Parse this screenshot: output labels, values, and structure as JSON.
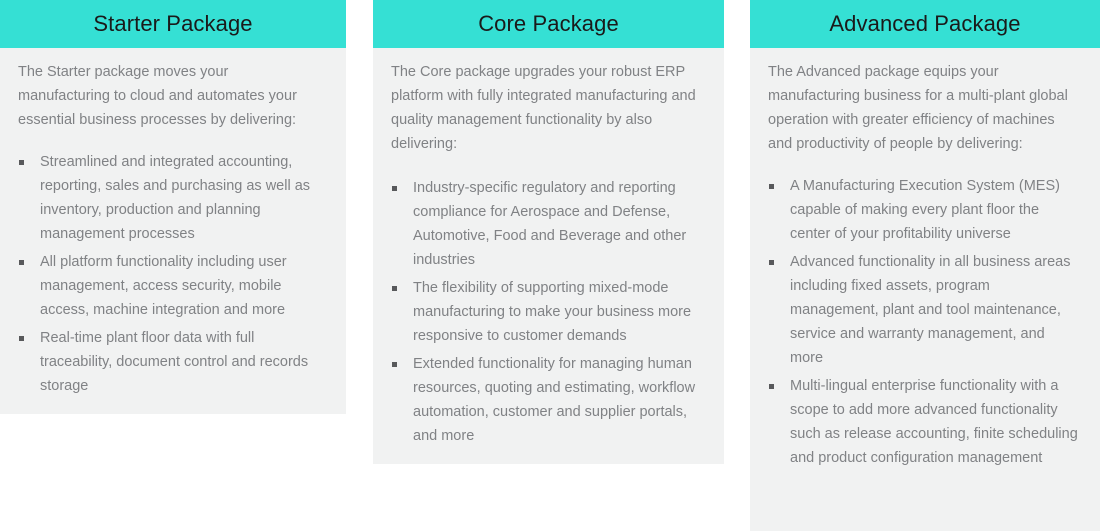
{
  "theme": {
    "header_background": "#35e0d4",
    "header_text_color": "#1a1a1a",
    "body_background": "#f1f2f2",
    "body_text_color": "#808285",
    "bullet_color": "#58595b",
    "page_background": "#ffffff"
  },
  "packages": [
    {
      "title": "Starter Package",
      "intro": "The Starter package moves your manufacturing to cloud and automates your essential business processes by delivering:",
      "items": [
        "Streamlined and integrated accounting, reporting, sales and purchasing as well as inventory, production and planning management processes",
        "All platform functionality including user management, access security, mobile access, machine integration and more",
        "Real-time plant floor data with full traceability, document control and records storage"
      ]
    },
    {
      "title": "Core Package",
      "intro": "The Core package upgrades your robust ERP platform with fully integrated manufacturing and quality management functionality by also delivering:",
      "items": [
        "Industry-specific regulatory and reporting compliance for Aerospace and Defense, Automotive, Food and Beverage and other industries",
        "The flexibility of supporting mixed-mode manufacturing to make your business more responsive to customer demands",
        "Extended functionality for managing human resources, quoting and estimating, workflow automation, customer and supplier portals, and more"
      ]
    },
    {
      "title": "Advanced Package",
      "intro": "The Advanced package equips your manufacturing business for a multi-plant global operation with greater efficiency of machines and productivity of people by delivering:",
      "items": [
        "A Manufacturing Execution System (MES) capable of making every plant floor the center of your profitability universe",
        "Advanced functionality in all business areas including fixed assets, program management, plant and tool maintenance, service and warranty management, and more",
        "Multi-lingual enterprise functionality with a scope to add more advanced functionality such as release accounting, finite scheduling and product configuration management"
      ]
    }
  ]
}
